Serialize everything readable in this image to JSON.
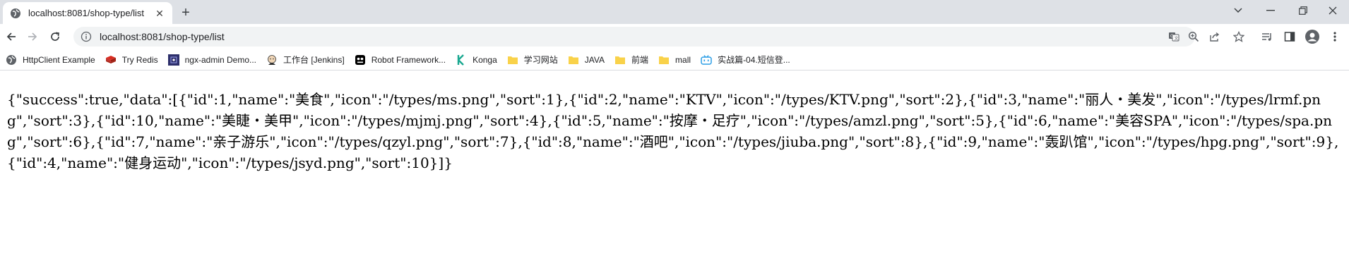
{
  "tab": {
    "title": "localhost:8081/shop-type/list",
    "close_symbol": "✕",
    "new_tab_symbol": "+"
  },
  "window_controls": {
    "dropdown": "⌄",
    "minimize": "–",
    "restore": "❐",
    "close": "✕"
  },
  "address_bar": {
    "url": "localhost:8081/shop-type/list"
  },
  "bookmarks": [
    {
      "label": "HttpClient Example",
      "icon": "globe-icon"
    },
    {
      "label": "Try Redis",
      "icon": "redis-icon"
    },
    {
      "label": "ngx-admin Demo...",
      "icon": "ngx-admin-icon"
    },
    {
      "label": "工作台 [Jenkins]",
      "icon": "jenkins-icon"
    },
    {
      "label": "Robot Framework...",
      "icon": "robot-icon"
    },
    {
      "label": "Konga",
      "icon": "konga-icon"
    },
    {
      "label": "学习网站",
      "icon": "folder-icon"
    },
    {
      "label": "JAVA",
      "icon": "folder-icon"
    },
    {
      "label": "前端",
      "icon": "folder-icon"
    },
    {
      "label": "mall",
      "icon": "folder-icon"
    },
    {
      "label": "实战篇-04.短信登...",
      "icon": "bilibili-icon"
    }
  ],
  "page": {
    "json_text": "{\"success\":true,\"data\":[{\"id\":1,\"name\":\"美食\",\"icon\":\"/types/ms.png\",\"sort\":1},{\"id\":2,\"name\":\"KTV\",\"icon\":\"/types/KTV.png\",\"sort\":2},{\"id\":3,\"name\":\"丽人・美发\",\"icon\":\"/types/lrmf.png\",\"sort\":3},{\"id\":10,\"name\":\"美睫・美甲\",\"icon\":\"/types/mjmj.png\",\"sort\":4},{\"id\":5,\"name\":\"按摩・足疗\",\"icon\":\"/types/amzl.png\",\"sort\":5},{\"id\":6,\"name\":\"美容SPA\",\"icon\":\"/types/spa.png\",\"sort\":6},{\"id\":7,\"name\":\"亲子游乐\",\"icon\":\"/types/qzyl.png\",\"sort\":7},{\"id\":8,\"name\":\"酒吧\",\"icon\":\"/types/jiuba.png\",\"sort\":8},{\"id\":9,\"name\":\"轰趴馆\",\"icon\":\"/types/hpg.png\",\"sort\":9},{\"id\":4,\"name\":\"健身运动\",\"icon\":\"/types/jsyd.png\",\"sort\":10}]}"
  },
  "colors": {
    "tabstrip_bg": "#dee1e6",
    "omnibox_bg": "#f1f3f4",
    "folder": "#f9d24a",
    "redis": "#c6302b",
    "konga": "#1aa891",
    "bilibili": "#2a9de6"
  }
}
